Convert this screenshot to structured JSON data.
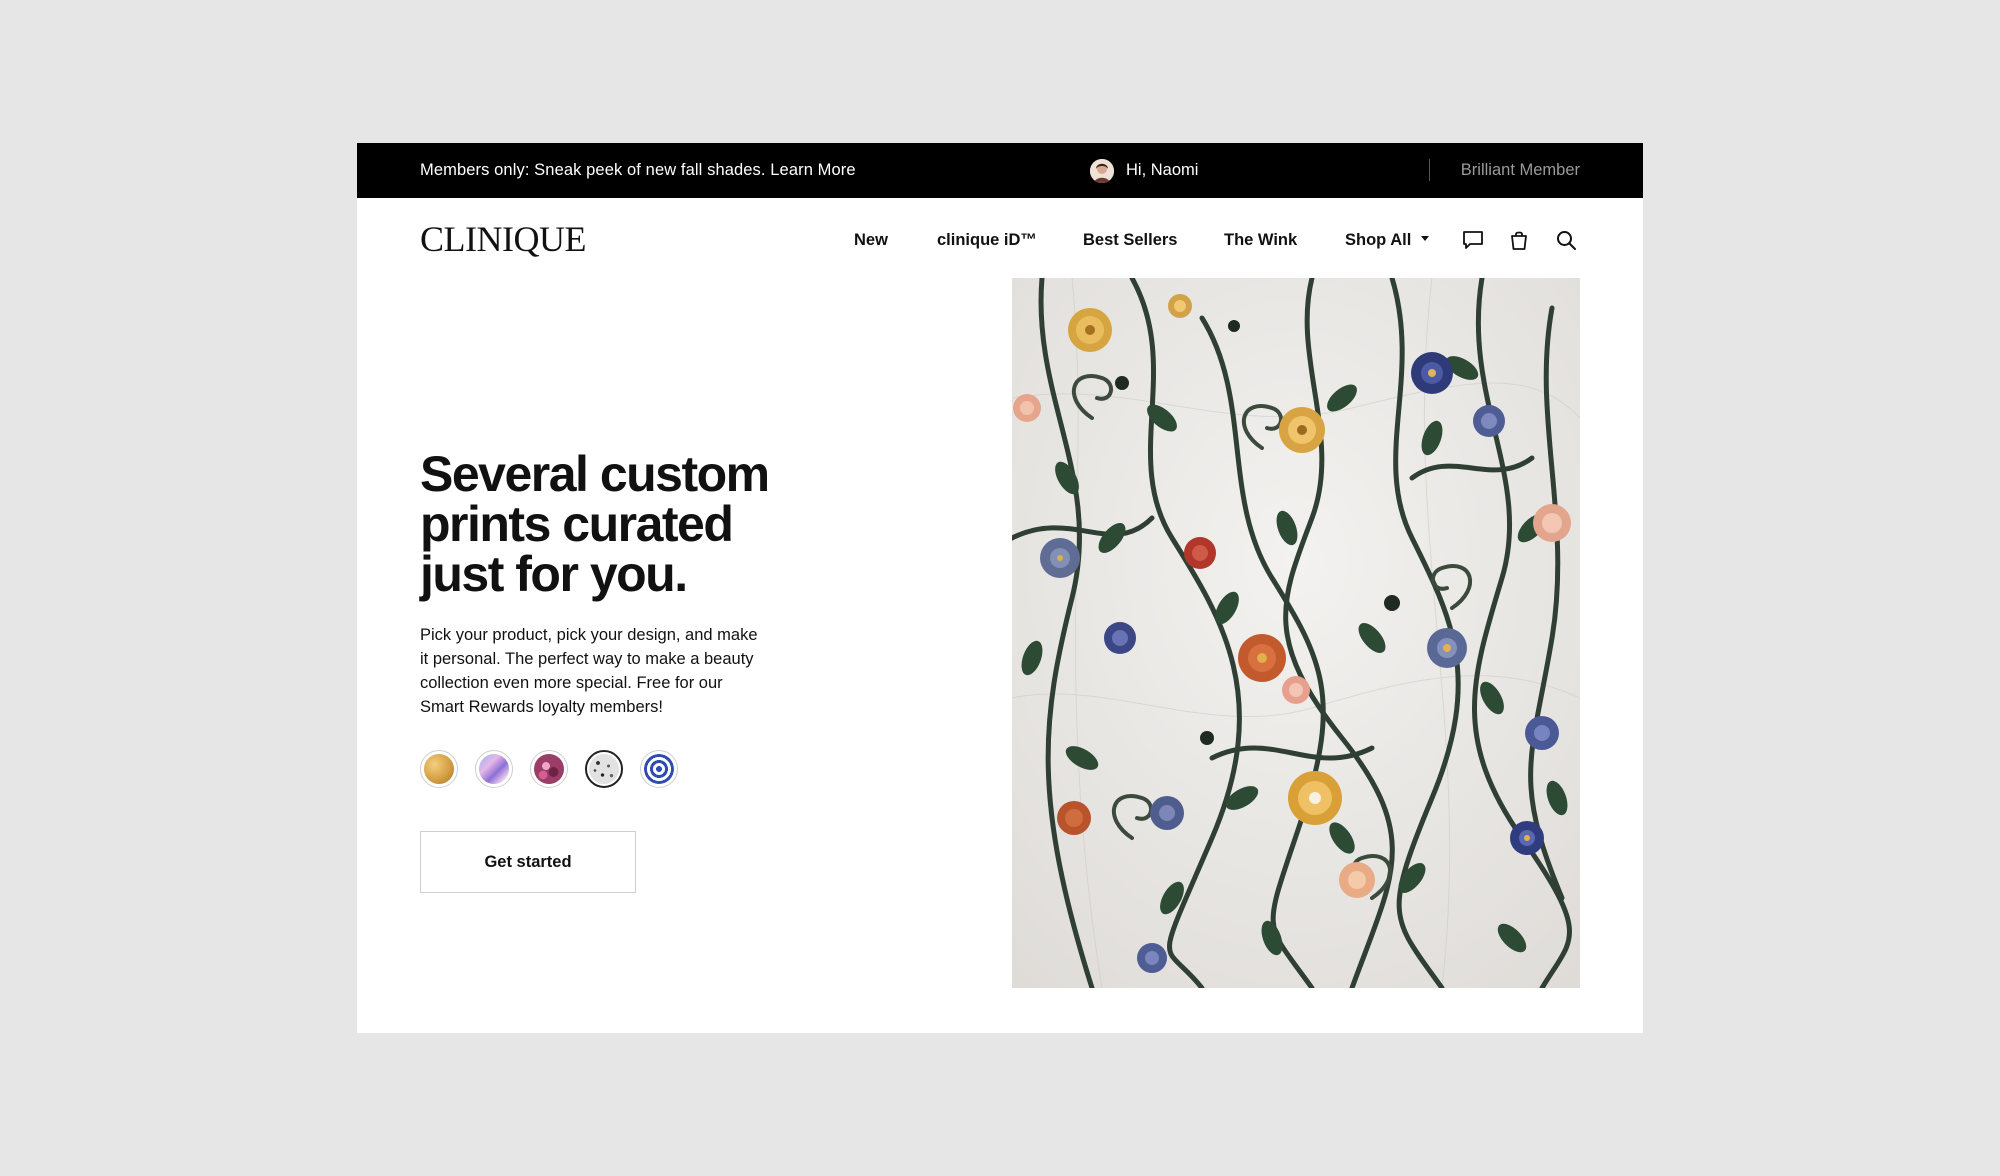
{
  "topbar": {
    "promo_text": "Members only: Sneak peek of new fall shades. Learn More",
    "greeting": "Hi, Naomi",
    "membership": "Brilliant Member"
  },
  "header": {
    "logo_text": "CLINIQUE",
    "nav": [
      {
        "label": "New"
      },
      {
        "label": "clinique iD™"
      },
      {
        "label": "Best Sellers"
      },
      {
        "label": "The Wink"
      },
      {
        "label": "Shop All"
      }
    ],
    "icons": [
      "chat-icon",
      "shopping-bag-icon",
      "search-icon"
    ]
  },
  "hero": {
    "headline_lines": [
      "Several custom",
      "prints curated",
      "just for you."
    ],
    "body_lines": [
      "Pick your product, pick your design, and make",
      "it personal. The perfect way to make a beauty",
      "collection even more special. Free for our",
      "Smart Rewards loyalty members!"
    ],
    "swatches": [
      {
        "name": "gold",
        "color": "#d9a650",
        "selected": false
      },
      {
        "name": "iridescent",
        "color": "#b7a4e6",
        "selected": false
      },
      {
        "name": "floral-pink",
        "color": "#b5487a",
        "selected": false
      },
      {
        "name": "speckle",
        "color": "#d8d8d8",
        "selected": true
      },
      {
        "name": "blue-spiral",
        "color": "#3c57b8",
        "selected": false
      }
    ],
    "cta_label": "Get started",
    "image_description_icon": "floral-inlay-image"
  },
  "colors": {
    "topbar_bg": "#000000",
    "page_bg": "#e6e6e6",
    "card_bg": "#ffffff",
    "muted_text": "#9a9a9a"
  }
}
